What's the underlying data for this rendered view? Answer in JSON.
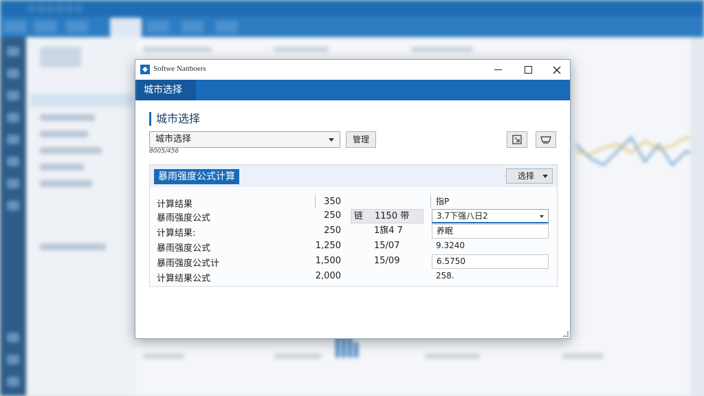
{
  "background": {
    "accent": "#1f6db4"
  },
  "dialog": {
    "title": "Softwe Nattboers",
    "header_tab": "城市选择",
    "section_title": "城市选择",
    "city_select": {
      "value": "城市选择"
    },
    "manage_button": "管理",
    "hint": "8005/456",
    "icons": {
      "edit": "edit-icon",
      "print": "print-icon",
      "close": "close-icon"
    }
  },
  "panel": {
    "title": "暴雨强度公式计算",
    "dropdown_label": "选择",
    "rows": [
      {
        "label": "计算结果",
        "value": "350",
        "mid_a": "",
        "mid_b": "",
        "right": "指P"
      },
      {
        "label": "暴雨强度公式",
        "value": "250",
        "mid_a": "链",
        "mid_b": "1150 带",
        "right": "3.7下强八日2"
      },
      {
        "label": "计算结果:",
        "value": "250",
        "mid_a": "",
        "mid_b": "1旗4 7",
        "right": "养眠"
      },
      {
        "label": "暴雨强度公式",
        "value": "1,250",
        "mid_a": "",
        "mid_b": "15/07",
        "right": "9.3240"
      },
      {
        "label": "暴雨强度公式计",
        "value": "1,500",
        "mid_a": "",
        "mid_b": "15/09",
        "right": "6.5750"
      },
      {
        "label": "计算结果公式",
        "value": "2,000",
        "mid_a": "",
        "mid_b": "",
        "right": "258."
      }
    ]
  }
}
